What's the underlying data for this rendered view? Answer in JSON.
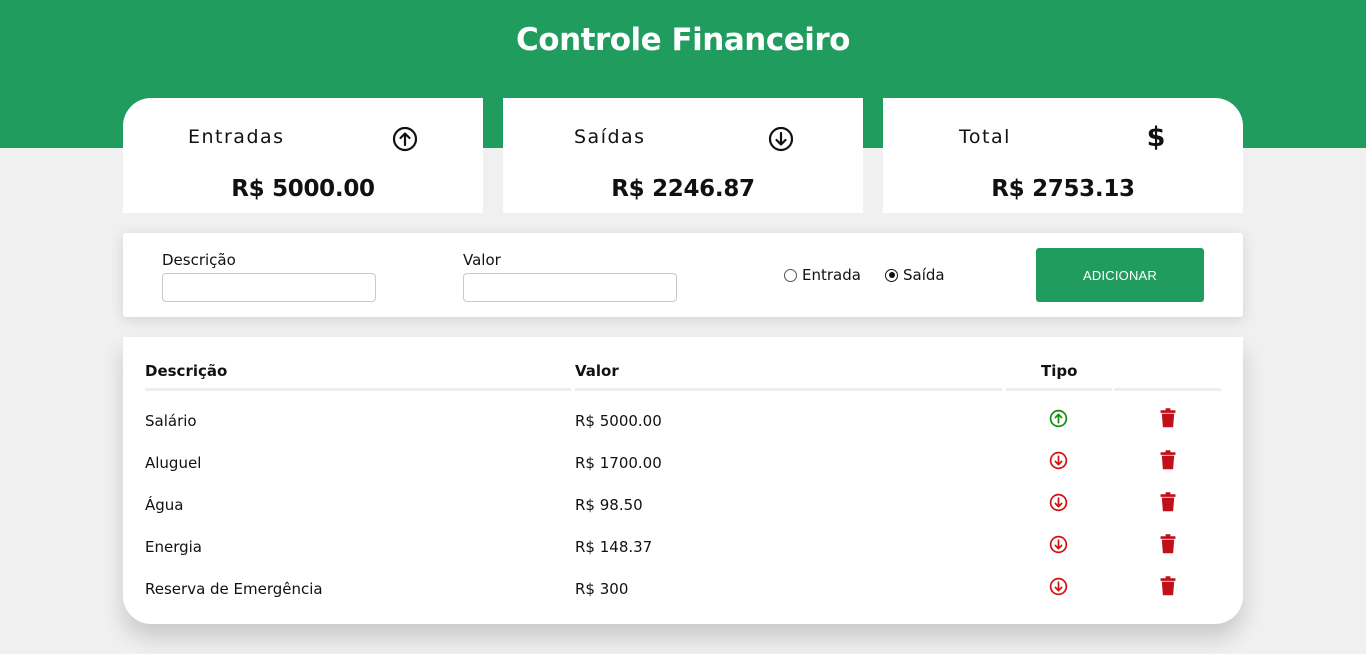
{
  "header": {
    "title": "Controle Financeiro",
    "bg_color": "#219c5f"
  },
  "cards": [
    {
      "label": "Entradas",
      "icon": "arrow-up-circle-icon",
      "value": "R$ 5000.00"
    },
    {
      "label": "Saídas",
      "icon": "arrow-down-circle-icon",
      "value": "R$ 2246.87"
    },
    {
      "label": "Total",
      "icon": "dollar-sign-icon",
      "icon_glyph": "$",
      "value": "R$ 2753.13"
    }
  ],
  "form": {
    "description_label": "Descrição",
    "description_value": "",
    "value_label": "Valor",
    "value_value": "",
    "radio_entrada": "Entrada",
    "radio_saida": "Saída",
    "selected_type": "Saída",
    "add_button": "ADICIONAR"
  },
  "table": {
    "headers": {
      "description": "Descrição",
      "value": "Valor",
      "type": "Tipo"
    },
    "rows": [
      {
        "description": "Salário",
        "value": "R$ 5000.00",
        "type": "entrada"
      },
      {
        "description": "Aluguel",
        "value": "R$ 1700.00",
        "type": "saida"
      },
      {
        "description": "Água",
        "value": "R$ 98.50",
        "type": "saida"
      },
      {
        "description": "Energia",
        "value": "R$ 148.37",
        "type": "saida"
      },
      {
        "description": "Reserva de Emergência",
        "value": "R$ 300",
        "type": "saida"
      }
    ]
  },
  "colors": {
    "accent": "#219c5f",
    "income": "#128a12",
    "expense": "#d11010",
    "delete": "#c0101a"
  }
}
